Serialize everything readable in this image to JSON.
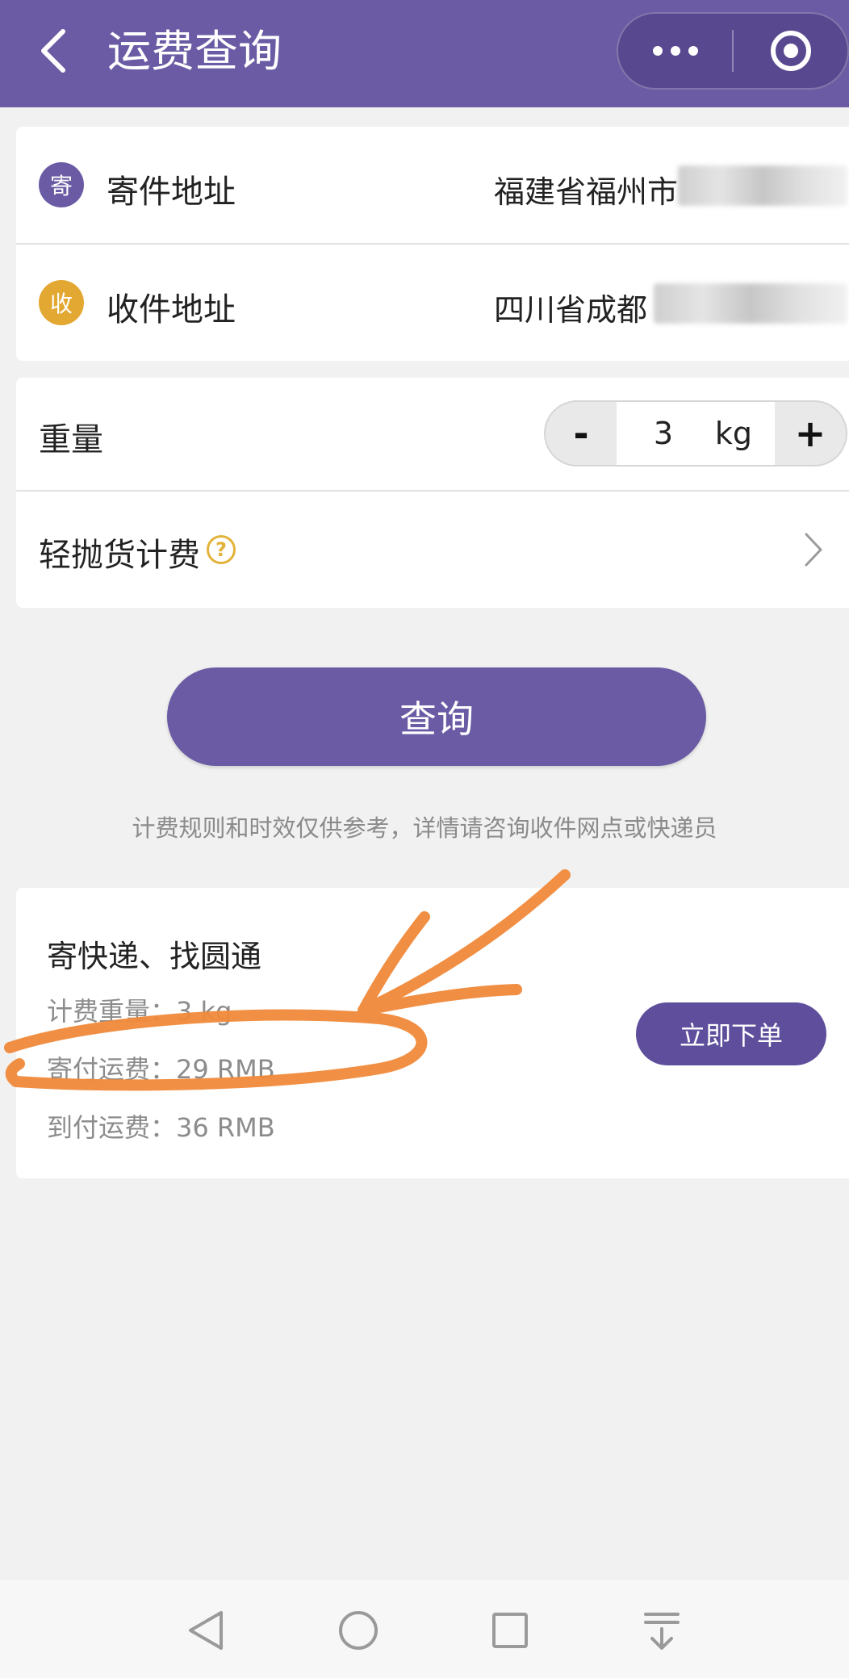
{
  "header": {
    "title": "运费查询"
  },
  "address": {
    "sender": {
      "badge": "寄",
      "label": "寄件地址",
      "value": "福建省福州市",
      "badge_color": "#6a5ba4"
    },
    "receiver": {
      "badge": "收",
      "label": "收件地址",
      "value": "四川省成都",
      "badge_color": "#e3a832"
    }
  },
  "weight": {
    "label": "重量",
    "minus_label": "-",
    "value": "3",
    "unit": "kg",
    "plus_label": "+"
  },
  "light_goods": {
    "label": "轻抛货计费",
    "help": "?"
  },
  "query_button": "查询",
  "disclaimer": "计费规则和时效仅供参考，详情请咨询收件网点或快递员",
  "result": {
    "title": "寄快递、找圆通",
    "billing_weight": "计费重量：3 kg",
    "prepaid_fee": "寄付运费：29 RMB",
    "collect_fee": "到付运费：36 RMB",
    "order_button": "立即下单"
  },
  "colors": {
    "brand": "#6a5ba4",
    "accent_yellow": "#e3a832",
    "annotation_orange": "#f08a3a"
  },
  "icons": {
    "back": "chevron-left-icon",
    "more": "more-dots-icon",
    "target": "target-circle-icon",
    "chevron": "chevron-right-icon",
    "nav_back": "triangle-back-icon",
    "nav_home": "circle-home-icon",
    "nav_recent": "square-recent-icon",
    "nav_menu": "download-lines-icon"
  }
}
